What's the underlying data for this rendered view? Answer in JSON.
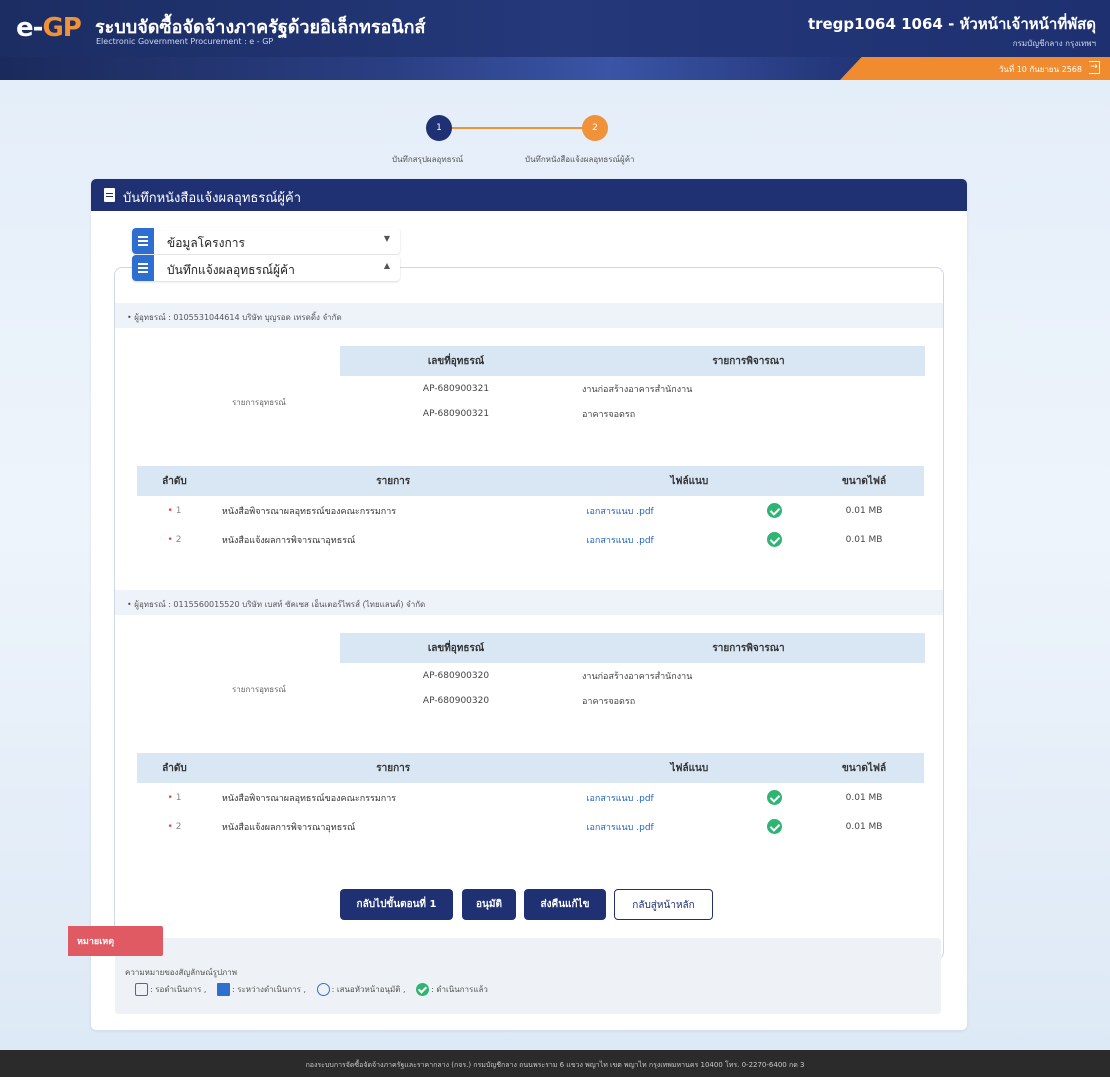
{
  "header": {
    "logo_e": "e-",
    "logo_gp": "GP",
    "title": "ระบบจัดซื้อจัดจ้างภาครัฐด้วยอิเล็กทรอนิกส์",
    "subtitle": "Electronic Government Procurement : e - GP",
    "user": "tregp1064 1064 - หัวหน้าเจ้าหน้าที่พัสดุ",
    "org": "กรมบัญชีกลาง กรุงเทพฯ",
    "date": "วันที่ 10 กันยายน 2568",
    "logout_icon": "logout-icon"
  },
  "stepper": {
    "steps": [
      {
        "number": "1",
        "label": "บันทึกสรุปผลอุทธรณ์"
      },
      {
        "number": "2",
        "label": "บันทึกหนังสือแจ้งผลอุทธรณ์ผู้ค้า"
      }
    ]
  },
  "card": {
    "title": "บันทึกหนังสือแจ้งผลอุทธรณ์ผู้ค้า",
    "accordions": [
      {
        "label": "ข้อมูลโครงการ",
        "state": "collapsed"
      },
      {
        "label": "บันทึกแจ้งผลอุทธรณ์ผู้ค้า",
        "state": "expanded"
      }
    ]
  },
  "labels": {
    "items_label": "รายการอุทธรณ์",
    "col_appeal_no": "เลขที่อุทธรณ์",
    "col_consider": "รายการพิจารณา",
    "col_no": "ลำดับ",
    "col_item": "รายการ",
    "col_file": "ไฟล์แนบ",
    "col_size": "ขนาดไฟล์"
  },
  "vendors": [
    {
      "title": "• ผู้อุทธรณ์ : 0105531044614 บริษัท บุญรอด เทรดดิ้ง จำกัด",
      "appeals": [
        {
          "no": "AP-680900321",
          "item": "งานก่อสร้างอาคารสำนักงาน"
        },
        {
          "no": "AP-680900321",
          "item": "อาคารจอดรถ"
        }
      ],
      "files": [
        {
          "seq": "1",
          "item": "หนังสือพิจารณาผลอุทธรณ์ของคณะกรรมการ",
          "file": "เอกสารแนบ .pdf",
          "size": "0.01 MB"
        },
        {
          "seq": "2",
          "item": "หนังสือแจ้งผลการพิจารณาอุทธรณ์",
          "file": "เอกสารแนบ .pdf",
          "size": "0.01 MB"
        }
      ]
    },
    {
      "title": "• ผู้อุทธรณ์ : 0115560015520 บริษัท เบสท์ ซัคเซส เอ็นเตอร์ไพรส์ (ไทยแลนด์) จำกัด",
      "appeals": [
        {
          "no": "AP-680900320",
          "item": "งานก่อสร้างอาคารสำนักงาน"
        },
        {
          "no": "AP-680900320",
          "item": "อาคารจอดรถ"
        }
      ],
      "files": [
        {
          "seq": "1",
          "item": "หนังสือพิจารณาผลอุทธรณ์ของคณะกรรมการ",
          "file": "เอกสารแนบ .pdf",
          "size": "0.01 MB"
        },
        {
          "seq": "2",
          "item": "หนังสือแจ้งผลการพิจารณาอุทธรณ์",
          "file": "เอกสารแนบ .pdf",
          "size": "0.01 MB"
        }
      ]
    }
  ],
  "buttons": {
    "back_step1": "กลับไปขั้นตอนที่ 1",
    "approve": "อนุมัติ",
    "return_edit": "ส่งคืนแก้ไข",
    "home": "กลับสู่หน้าหลัก"
  },
  "remark": {
    "tag": "หมายเหตุ",
    "text": "ความหมายของสัญลักษณ์รูปภาพ",
    "legend": [
      {
        "icon": "edit-icon",
        "label": ": รอดำเนินการ ,"
      },
      {
        "icon": "save-icon",
        "label": ": ระหว่างดำเนินการ ,"
      },
      {
        "icon": "user-icon",
        "label": ": เสนอหัวหน้าอนุมัติ ,"
      },
      {
        "icon": "check-icon",
        "label": ": ดำเนินการแล้ว"
      }
    ]
  },
  "footer": {
    "text": "กองระบบการจัดซื้อจัดจ้างภาครัฐและราคากลาง (กจร.) กรมบัญชีกลาง ถนนพระราม 6 แขวง พญาไท เขต พญาไท กรุงเทพมหานคร 10400 โทร. 0-2270-6400 กด 3"
  },
  "colors": {
    "primary": "#1f3173",
    "accent": "#f0923a",
    "success": "#2fb573",
    "remark": "#e05a64"
  }
}
